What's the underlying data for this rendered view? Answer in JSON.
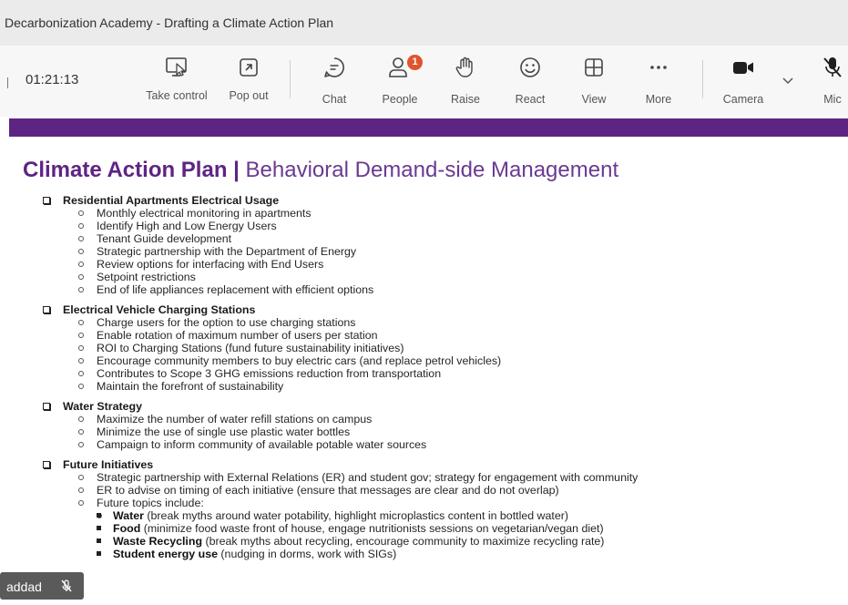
{
  "window": {
    "title": "Decarbonization Academy - Drafting a Climate Action Plan"
  },
  "toolbar": {
    "timer": "01:21:13",
    "buttons": [
      {
        "label": "Take control",
        "icon": "take-control-icon"
      },
      {
        "label": "Pop out",
        "icon": "pop-out-icon"
      },
      {
        "label": "Chat",
        "icon": "chat-icon"
      },
      {
        "label": "People",
        "icon": "people-icon",
        "badge": "1"
      },
      {
        "label": "Raise",
        "icon": "raise-hand-icon"
      },
      {
        "label": "React",
        "icon": "react-smiley-icon"
      },
      {
        "label": "View",
        "icon": "view-grid-icon"
      },
      {
        "label": "More",
        "icon": "more-dots-icon"
      },
      {
        "label": "Camera",
        "icon": "camera-icon"
      },
      {
        "label": "Mic",
        "icon": "mic-muted-icon"
      }
    ],
    "badge_color": "#e0542e"
  },
  "slide": {
    "accent_color": "#5e2483",
    "title_bold": "Climate Action Plan |",
    "title_light": "Behavioral Demand-side Management",
    "sections": [
      {
        "heading": "Residential Apartments Electrical Usage",
        "items": [
          "Monthly electrical monitoring in apartments",
          "Identify High and Low Energy Users",
          "Tenant Guide development",
          "Strategic partnership with the Department of Energy",
          "Review options for interfacing with End Users",
          "Setpoint restrictions",
          "End of life appliances replacement with efficient options"
        ]
      },
      {
        "heading": "Electrical Vehicle Charging Stations",
        "items": [
          "Charge users for the option to use charging stations",
          "Enable rotation of maximum number of users per station",
          "ROI to Charging Stations (fund future sustainability initiatives)",
          "Encourage community members to buy electric cars (and replace petrol vehicles)",
          "Contributes to Scope 3 GHG emissions reduction from transportation",
          "Maintain the forefront of sustainability"
        ]
      },
      {
        "heading": "Water Strategy",
        "items": [
          "Maximize the number of water refill stations on campus",
          "Minimize the use of single use plastic water bottles",
          "Campaign to inform community of available potable water sources"
        ]
      },
      {
        "heading": "Future Initiatives",
        "items": [
          "Strategic partnership with External Relations (ER) and student gov; strategy for engagement with community",
          "ER to advise on timing of each initiative (ensure that messages are clear and do not overlap)",
          "Future topics include:"
        ],
        "subitems": [
          {
            "key": "Water",
            "text": " (break myths around water potability, highlight microplastics content in bottled water)"
          },
          {
            "key": "Food",
            "text": " (minimize food waste front of house, engage nutritionists sessions on vegetarian/vegan diet)"
          },
          {
            "key": "Waste Recycling",
            "text": " (break myths about recycling, encourage community to maximize recycling rate)"
          },
          {
            "key": "Student energy use",
            "text": " (nudging in dorms, work with SIGs)"
          }
        ]
      }
    ]
  },
  "participant": {
    "name": "addad",
    "icon": "mic-muted-icon"
  }
}
